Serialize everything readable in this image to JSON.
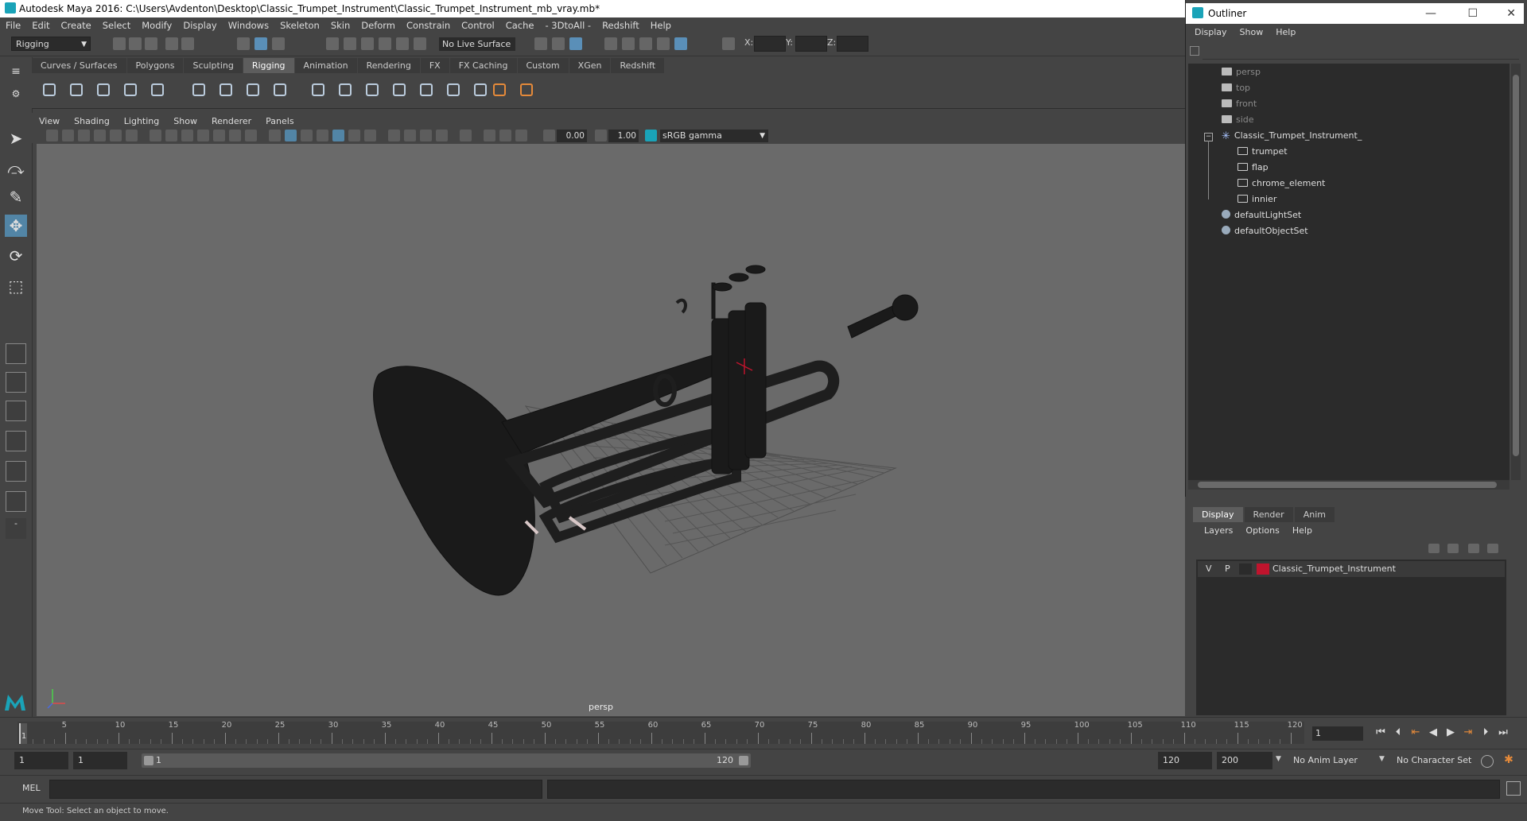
{
  "app": {
    "title": "Autodesk Maya 2016: C:\\Users\\Avdenton\\Desktop\\Classic_Trumpet_Instrument\\Classic_Trumpet_Instrument_mb_vray.mb*"
  },
  "menubar": [
    "File",
    "Edit",
    "Create",
    "Select",
    "Modify",
    "Display",
    "Windows",
    "Skeleton",
    "Skin",
    "Deform",
    "Constrain",
    "Control",
    "Cache",
    "- 3DtoAll -",
    "Redshift",
    "Help"
  ],
  "statusline": {
    "mode": "Rigging",
    "live_surface": "No Live Surface",
    "x_label": "X:",
    "y_label": "Y:",
    "z_label": "Z:"
  },
  "shelf": {
    "tabs": [
      "Curves / Surfaces",
      "Polygons",
      "Sculpting",
      "Rigging",
      "Animation",
      "Rendering",
      "FX",
      "FX Caching",
      "Custom",
      "XGen",
      "Redshift"
    ],
    "active": "Rigging"
  },
  "viewport": {
    "menu": [
      "View",
      "Shading",
      "Lighting",
      "Show",
      "Renderer",
      "Panels"
    ],
    "exposure": "0.00",
    "gamma_value": "1.00",
    "color_space": "sRGB gamma",
    "camera_label": "persp"
  },
  "outliner": {
    "title": "Outliner",
    "menu": [
      "Display",
      "Show",
      "Help"
    ],
    "items": [
      {
        "label": "persp",
        "kind": "camera",
        "dim": true
      },
      {
        "label": "top",
        "kind": "camera",
        "dim": true
      },
      {
        "label": "front",
        "kind": "camera",
        "dim": true
      },
      {
        "label": "side",
        "kind": "camera",
        "dim": true
      },
      {
        "label": "Classic_Trumpet_Instrument_",
        "kind": "group",
        "dim": false
      },
      {
        "label": "trumpet",
        "kind": "mesh",
        "dim": false
      },
      {
        "label": "flap",
        "kind": "mesh",
        "dim": false
      },
      {
        "label": "chrome_element",
        "kind": "mesh",
        "dim": false
      },
      {
        "label": "innier",
        "kind": "mesh",
        "dim": false
      },
      {
        "label": "defaultLightSet",
        "kind": "set",
        "dim": false
      },
      {
        "label": "defaultObjectSet",
        "kind": "set",
        "dim": false
      }
    ]
  },
  "layers": {
    "tabs": [
      "Display",
      "Render",
      "Anim"
    ],
    "active": "Display",
    "menu": [
      "Layers",
      "Options",
      "Help"
    ],
    "rows": [
      {
        "v": "V",
        "p": "P",
        "name": "Classic_Trumpet_Instrument",
        "color": "#c0142d"
      }
    ]
  },
  "timeline": {
    "ticks": [
      "5",
      "10",
      "15",
      "20",
      "25",
      "30",
      "35",
      "40",
      "45",
      "50",
      "55",
      "60",
      "65",
      "70",
      "75",
      "80",
      "85",
      "90",
      "95",
      "100",
      "105",
      "110",
      "115",
      "120"
    ],
    "current_marker": "1",
    "current_frame": "1"
  },
  "range": {
    "start": "1",
    "playback_start": "1",
    "slider_start": "1",
    "slider_end": "120",
    "playback_end": "120",
    "end": "200",
    "anim_layer": "No Anim Layer",
    "character_set": "No Character Set"
  },
  "cmd": {
    "label": "MEL"
  },
  "help": {
    "text": "Move Tool: Select an object to move."
  },
  "colors": {
    "accent": "#5285a6",
    "maya_teal": "#1aa3b8",
    "layer_red": "#c0142d"
  }
}
